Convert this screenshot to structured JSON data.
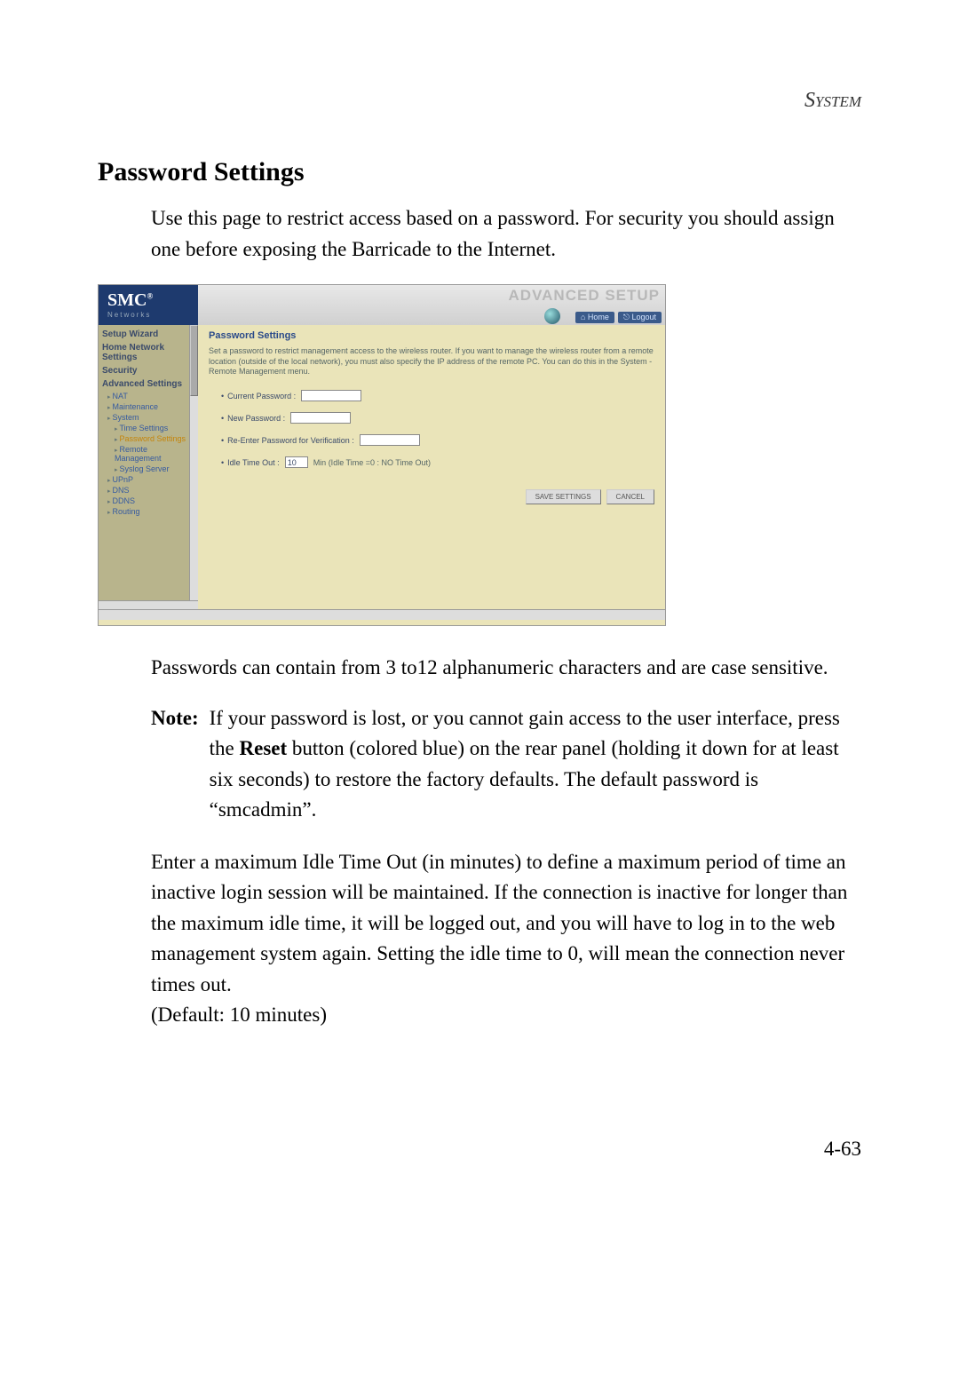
{
  "header": {
    "section": "System"
  },
  "title": "Password Settings",
  "intro": "Use this page to restrict access based on a password. For security you should assign one before exposing the Barricade to the Internet.",
  "screenshot": {
    "logo": "SMC",
    "logo_sub": "Networks",
    "banner": "ADVANCED SETUP",
    "topnav": {
      "home": "Home",
      "logout": "Logout"
    },
    "sidebar": {
      "m0": "Setup Wizard",
      "m1": "Home Network Settings",
      "m2": "Security",
      "m3": "Advanced Settings",
      "s_nat": "NAT",
      "s_maint": "Maintenance",
      "s_system": "System",
      "s_time": "Time Settings",
      "s_pwd": "Password Settings",
      "s_remote": "Remote Management",
      "s_syslog": "Syslog Server",
      "s_upnp": "UPnP",
      "s_dns": "DNS",
      "s_ddns": "DDNS",
      "s_routing": "Routing"
    },
    "content": {
      "title": "Password Settings",
      "desc": "Set a password to restrict management access to the wireless router. If you want to manage the wireless router from a remote location (outside of the local network), you must also specify the IP address of the remote PC. You can do this in the System - Remote Management menu.",
      "f_current": "Current Password :",
      "f_new": "New Password :",
      "f_reenter": "Re-Enter Password for Verification :",
      "f_idle": "Idle Time Out :",
      "f_idle_value": "10",
      "f_idle_hint": "Min (Idle Time =0 : NO Time Out)",
      "btn_save": "SAVE SETTINGS",
      "btn_cancel": "CANCEL"
    }
  },
  "p2": "Passwords can contain from 3 to12 alphanumeric characters and are case sensitive.",
  "note": {
    "label": "Note:",
    "part1": "If your password is lost, or you cannot gain access to the user interface, press the ",
    "bold": "Reset",
    "part2": " button (colored blue) on the rear panel (holding it down for at least six seconds) to restore the factory defaults. The default password is “smcadmin”."
  },
  "p3": "Enter a maximum Idle Time Out (in minutes) to define a maximum period of time an inactive login session will be maintained. If the connection is inactive for longer than the maximum idle time, it will be logged out, and you will have to log in to the web management system again. Setting the idle time to 0, will mean the connection never times out.\n(Default: 10 minutes)",
  "pagenum": "4-63"
}
